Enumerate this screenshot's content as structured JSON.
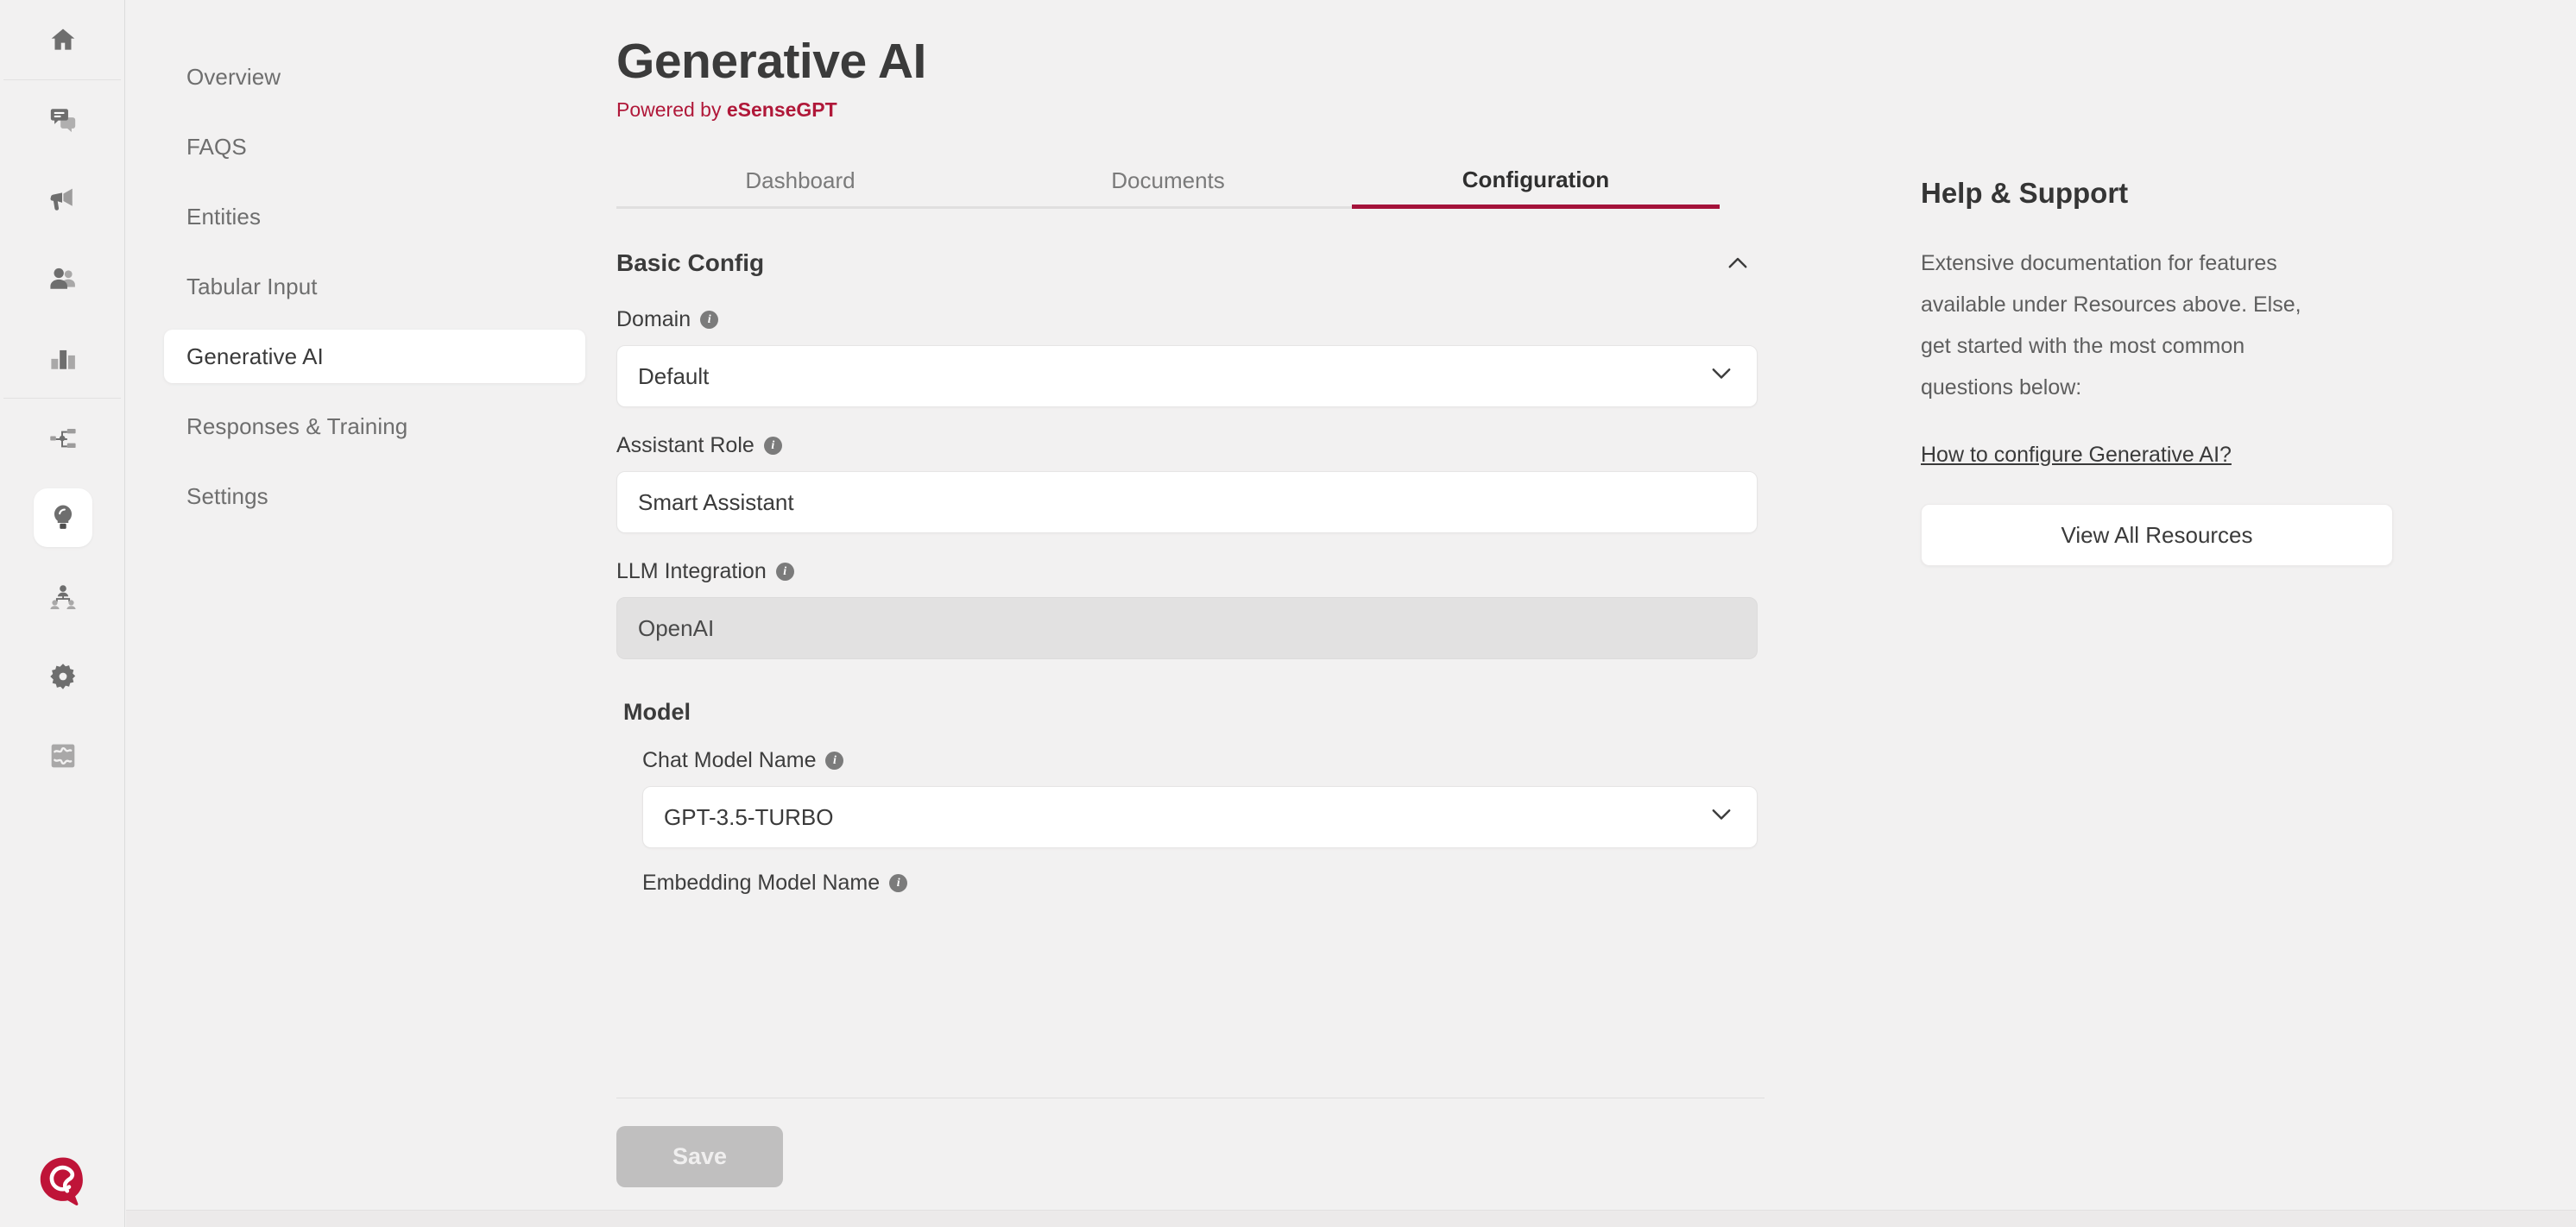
{
  "icon_rail": {
    "groups": [
      {
        "items": [
          {
            "name": "home-icon",
            "label": "Home",
            "active": false
          }
        ]
      },
      {
        "items": [
          {
            "name": "chat-icon",
            "label": "Conversations",
            "active": false
          },
          {
            "name": "megaphone-icon",
            "label": "Campaigns",
            "active": false
          },
          {
            "name": "users-icon",
            "label": "Contacts",
            "active": false
          },
          {
            "name": "bar-chart-icon",
            "label": "Analytics",
            "active": false
          }
        ]
      },
      {
        "items": [
          {
            "name": "sitemap-icon",
            "label": "Flows",
            "active": false
          },
          {
            "name": "lightbulb-icon",
            "label": "Generative AI",
            "active": true
          },
          {
            "name": "hierarchy-icon",
            "label": "Teams",
            "active": false
          },
          {
            "name": "gear-icon",
            "label": "Settings",
            "active": false
          },
          {
            "name": "puzzle-icon",
            "label": "Integrations",
            "active": false
          }
        ]
      }
    ],
    "logo": {
      "name": "brand-logo",
      "label": "eSense"
    }
  },
  "sidebar": {
    "items": [
      {
        "label": "Overview",
        "active": false
      },
      {
        "label": "FAQS",
        "active": false
      },
      {
        "label": "Entities",
        "active": false
      },
      {
        "label": "Tabular Input",
        "active": false
      },
      {
        "label": "Generative AI",
        "active": true
      },
      {
        "label": "Responses & Training",
        "active": false
      },
      {
        "label": "Settings",
        "active": false
      }
    ]
  },
  "header": {
    "title": "Generative AI",
    "powered_prefix": "Powered by ",
    "powered_brand": "eSenseGPT"
  },
  "tabs": [
    {
      "label": "Dashboard",
      "active": false
    },
    {
      "label": "Documents",
      "active": false
    },
    {
      "label": "Configuration",
      "active": true
    }
  ],
  "basic_config": {
    "section_title": "Basic Config",
    "collapse_icon": "chevron-up-icon",
    "fields": {
      "domain": {
        "label": "Domain",
        "info_icon": "info-icon",
        "value": "Default",
        "type": "select",
        "chevron": "chevron-down-icon",
        "options": [
          "Default"
        ]
      },
      "assistant_role": {
        "label": "Assistant Role",
        "info_icon": "info-icon",
        "value": "Smart Assistant",
        "placeholder": "Smart Assistant",
        "type": "text"
      },
      "llm_integration": {
        "label": "LLM Integration",
        "info_icon": "info-icon",
        "value": "OpenAI",
        "type": "readonly"
      }
    },
    "model_group": {
      "title": "Model",
      "chat_model": {
        "label": "Chat Model Name",
        "info_icon": "info-icon",
        "value": "GPT-3.5-TURBO",
        "type": "select",
        "chevron": "chevron-down-icon",
        "options": [
          "GPT-3.5-TURBO"
        ]
      },
      "embedding_model": {
        "label": "Embedding Model Name",
        "info_icon": "info-icon",
        "type": "select"
      }
    }
  },
  "actions": {
    "save_label": "Save",
    "save_disabled": true
  },
  "help": {
    "title": "Help & Support",
    "body": "Extensive documentation for features available under Resources above. Else, get started with the most common questions below:",
    "link_label": "How to configure Generative AI?",
    "button_label": "View All Resources"
  },
  "colors": {
    "accent": "#a4123a",
    "brand_red": "#b01839",
    "page_bg": "#f2f1f1",
    "card_bg": "#ffffff",
    "disabled_bg": "#e2e1e1",
    "text_primary": "#3b3b3b",
    "text_muted": "#6e6e6e",
    "save_disabled_bg": "#c0bfbf"
  }
}
